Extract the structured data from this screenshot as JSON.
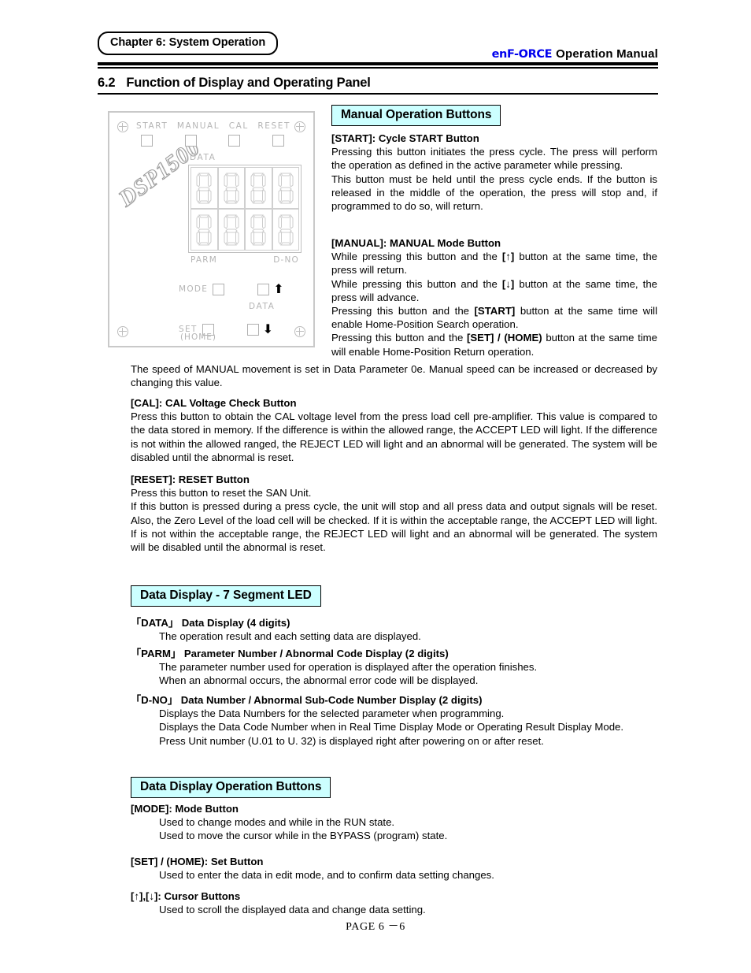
{
  "header": {
    "chapter_tag": "Chapter 6: System Operation",
    "brand": "enF-ORCE",
    "manual_title": "Operation  Manual"
  },
  "section": {
    "number": "6.2",
    "title": "Function of Display and Operating Panel"
  },
  "panel": {
    "watermark": "DSP1500",
    "top_buttons": [
      "START",
      "MANUAL",
      "CAL",
      "RESET"
    ],
    "display_label_top": "DATA",
    "display_label_parm": "PARM",
    "display_label_dno": "D-NO",
    "mode_label": "MODE",
    "set_label": "SET",
    "home_label": "(HOME)",
    "data_label": "DATA",
    "up_arrow": "↑",
    "down_arrow": "↓"
  },
  "manual_ops": {
    "heading": "Manual Operation Buttons",
    "start_head": "[START]:   Cycle START Button",
    "start_p1": "Pressing this button initiates the press cycle. The press will perform the operation as defined in the active parameter while pressing.",
    "start_p2": "This button must be held until the press cycle ends. If the button is released in the middle of the operation, the press will stop and, if programmed to do so, will return.",
    "manual_head": "[MANUAL]:   MANUAL Mode Button",
    "manual_l1_a": "While pressing this button and the ",
    "manual_l1_key": "[↑]",
    "manual_l1_b": " button at the same time, the press will return.",
    "manual_l2_a": "While pressing this button and the ",
    "manual_l2_key": "[↓]",
    "manual_l2_b": " button at the same time, the press will advance.",
    "manual_l3_a": "Pressing this button and the ",
    "manual_l3_key": "[START]",
    "manual_l3_b": " button at the same time will enable Home-Position Search operation.",
    "manual_l4_a": "Pressing this button and the ",
    "manual_l4_key": "[SET] / (HOME)",
    "manual_l4_b": " button at the same time will enable Home-Position Return operation.",
    "speed_note": "The speed of MANUAL movement is set in Data Parameter 0e. Manual speed can be increased or decreased by changing this value.",
    "cal_head": "[CAL]:   CAL Voltage Check Button",
    "cal_body": "Press this button to obtain the CAL voltage level from the press load cell pre-amplifier. This value is compared to the data stored in memory. If the difference is within the allowed range, the ACCEPT LED will light. If the difference is not within the allowed ranged, the REJECT LED will light and an abnormal will be generated. The system will be disabled until the abnormal is reset.",
    "reset_head": "[RESET]:   RESET Button",
    "reset_p1": "Press this button to reset the SAN Unit.",
    "reset_p2": "If this button is pressed during a press cycle, the unit will stop and all press data and output signals will be reset. Also, the Zero Level of the load cell will be checked. If it is within the acceptable range, the ACCEPT LED will light. If is not within the acceptable range, the REJECT LED will light and an abnormal will be generated. The system will be disabled until the abnormal is reset."
  },
  "data_display": {
    "heading": "Data Display - 7 Segment LED",
    "data_head": "「DATA」 Data Display (4 digits)",
    "data_body": "The operation result and each setting data are displayed.",
    "parm_head": "「PARM」 Parameter Number / Abnormal Code Display (2 digits)",
    "parm_body1": "The parameter number used for operation is displayed after the operation finishes.",
    "parm_body2": "When an abnormal occurs, the abnormal error code will be displayed.",
    "dno_head": "「D-NO」 Data Number / Abnormal Sub-Code Number Display (2 digits)",
    "dno_body1": "Displays the Data Numbers for the selected parameter when programming.",
    "dno_body2": "Displays the Data Code Number when in Real Time Display Mode or Operating Result Display Mode.",
    "dno_body3": "Press Unit number (U.01 to U. 32) is displayed right after powering on or after reset."
  },
  "data_ops": {
    "heading": "Data Display Operation Buttons",
    "mode_head": "[MODE]:   Mode Button",
    "mode_body1": "Used to change modes and while in the RUN state.",
    "mode_body2": "Used to move the cursor while in the BYPASS (program) state.",
    "set_head": "[SET] / (HOME):   Set Button",
    "set_body": "Used to enter the data in edit mode, and to confirm data setting changes.",
    "cursor_head": "[↑],[↓]:   Cursor Buttons",
    "cursor_body": "Used to scroll the displayed data and change data setting."
  },
  "footer": {
    "page": "PAGE  6 －6"
  },
  "colors": {
    "heading_bg": "#CCFFFF",
    "brand": "#0000EE",
    "panel_line": "#c0c0c0"
  }
}
